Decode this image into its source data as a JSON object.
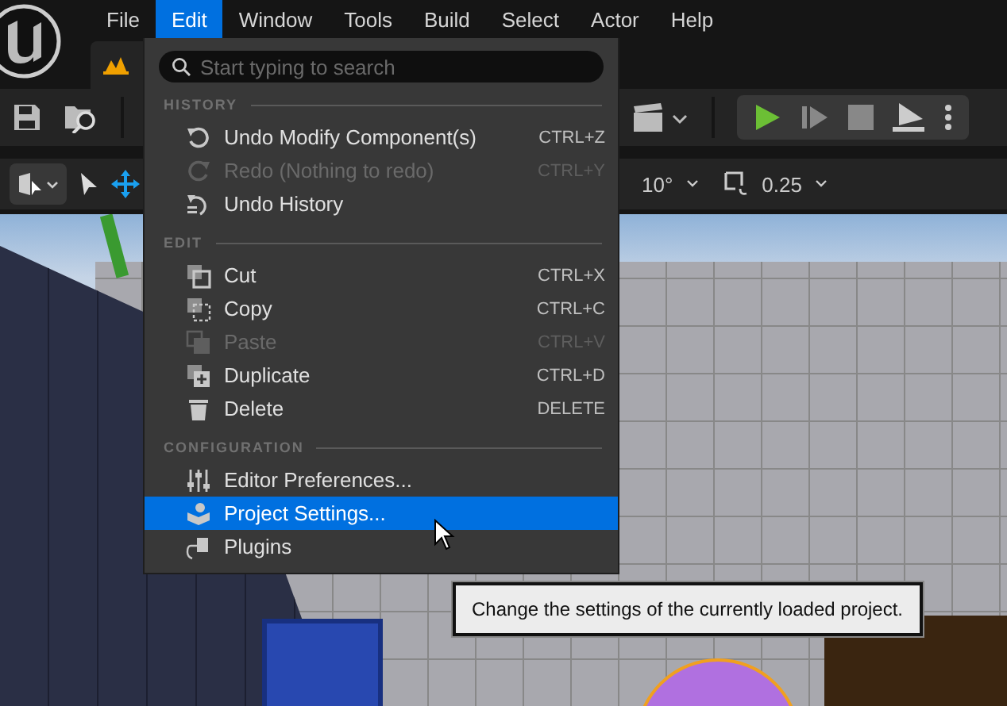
{
  "menubar": [
    {
      "label": "File",
      "selected": false
    },
    {
      "label": "Edit",
      "selected": true
    },
    {
      "label": "Window",
      "selected": false
    },
    {
      "label": "Tools",
      "selected": false
    },
    {
      "label": "Build",
      "selected": false
    },
    {
      "label": "Select",
      "selected": false
    },
    {
      "label": "Actor",
      "selected": false
    },
    {
      "label": "Help",
      "selected": false
    }
  ],
  "viewport_toolbar": {
    "rotation_snap": "10°",
    "scale_snap": "0.25"
  },
  "edit_menu": {
    "search": {
      "placeholder": "Start typing to search"
    },
    "sections": [
      {
        "heading": "HISTORY",
        "items": [
          {
            "label": "Undo Modify Component(s)",
            "shortcut": "CTRL+Z",
            "disabled": false,
            "selected": false
          },
          {
            "label": "Redo (Nothing to redo)",
            "shortcut": "CTRL+Y",
            "disabled": true,
            "selected": false
          },
          {
            "label": "Undo History",
            "disabled": false,
            "selected": false
          }
        ]
      },
      {
        "heading": "EDIT",
        "items": [
          {
            "label": "Cut",
            "shortcut": "CTRL+X",
            "disabled": false,
            "selected": false
          },
          {
            "label": "Copy",
            "shortcut": "CTRL+C",
            "disabled": false,
            "selected": false
          },
          {
            "label": "Paste",
            "shortcut": "CTRL+V",
            "disabled": true,
            "selected": false
          },
          {
            "label": "Duplicate",
            "shortcut": "CTRL+D",
            "disabled": false,
            "selected": false
          },
          {
            "label": "Delete",
            "shortcut": "DELETE",
            "disabled": false,
            "selected": false
          }
        ]
      },
      {
        "heading": "CONFIGURATION",
        "items": [
          {
            "label": "Editor Preferences...",
            "disabled": false,
            "selected": false
          },
          {
            "label": "Project Settings...",
            "disabled": false,
            "selected": true
          },
          {
            "label": "Plugins",
            "disabled": false,
            "selected": false
          }
        ]
      }
    ]
  },
  "tooltip": "Change the settings of the currently loaded project."
}
